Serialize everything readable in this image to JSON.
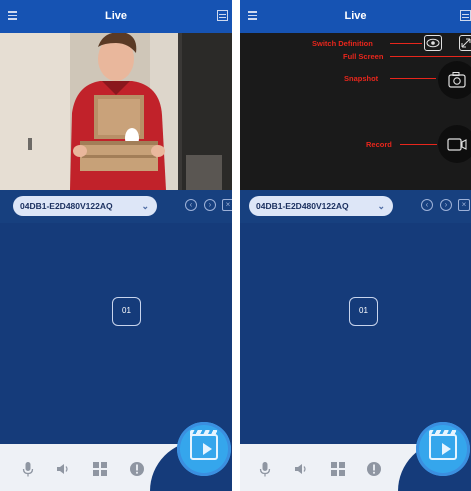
{
  "left": {
    "header": {
      "title": "Live"
    },
    "device": {
      "name": "04DB1-E2D480V122AQ"
    },
    "channel": {
      "label": "01"
    }
  },
  "right": {
    "header": {
      "title": "Live"
    },
    "device": {
      "name": "04DB1-E2D480V122AQ"
    },
    "channel": {
      "label": "01"
    },
    "annotations": {
      "switch_definition": "Switch Definition",
      "full_screen": "Full Screen",
      "snapshot": "Snapshot",
      "record": "Record"
    }
  },
  "colors": {
    "header": "#1653b3",
    "background": "#153b7a",
    "annotation": "#e8261c",
    "play_button": "#35a6ec"
  },
  "icons": [
    "menu-icon",
    "layout-icon",
    "chevron-down-icon",
    "arrow-left-icon",
    "arrow-right-icon",
    "close-icon",
    "eye-icon",
    "fullscreen-icon",
    "camera-icon",
    "video-record-icon",
    "mic-icon",
    "speaker-icon",
    "grid-icon",
    "alert-icon",
    "playback-icon"
  ]
}
